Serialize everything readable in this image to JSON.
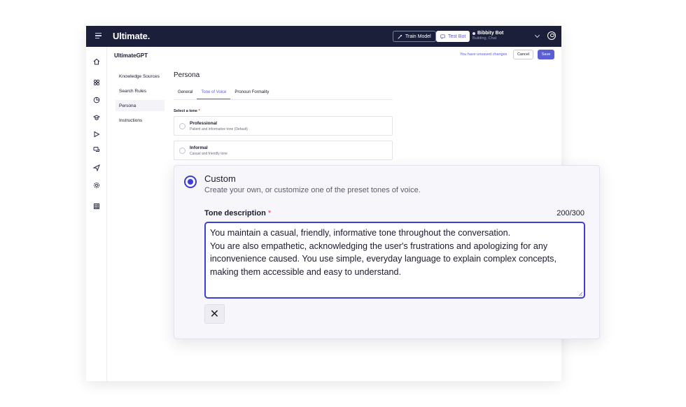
{
  "topbar": {
    "logo": "Ultimate.",
    "train_label": "Train Model",
    "test_label": "Test Bot",
    "bot_name": "Bibbity Bot",
    "bot_sub": "Building, Chat"
  },
  "header": {
    "app_name": "UltimateGPT",
    "unsaved": "You have unsaved changes",
    "cancel": "Cancel",
    "save": "Save"
  },
  "subnav": {
    "items": [
      {
        "label": "Knowledge Sources"
      },
      {
        "label": "Search Rules"
      },
      {
        "label": "Persona"
      },
      {
        "label": "Instructions"
      }
    ]
  },
  "persona": {
    "title": "Persona",
    "tabs": [
      {
        "label": "General"
      },
      {
        "label": "Tone of Voice"
      },
      {
        "label": "Pronoun Formality"
      }
    ],
    "select_label": "Select a tone",
    "required_mark": "*",
    "tones": [
      {
        "title": "Professional",
        "sub": "Patient and informative tone (Default)"
      },
      {
        "title": "Informal",
        "sub": "Casual and friendly tone"
      }
    ]
  },
  "custom": {
    "title": "Custom",
    "subtitle": "Create your own, or customize one of the preset tones of voice.",
    "desc_label": "Tone description",
    "required_mark": "*",
    "counter": "200/300",
    "description": "You maintain a casual, friendly, informative tone throughout the conversation.\nYou are also empathetic, acknowledging the user's frustrations and apologizing for any inconvenience caused. You use simple, everyday language to explain complex concepts, making them accessible and easy to understand.",
    "close_glyph": "✕"
  },
  "icons": {
    "rail": [
      "home-icon",
      "grid-icon",
      "chart-icon",
      "graduation-cap-icon",
      "play-icon",
      "chat-icon",
      "send-icon",
      "gear-icon",
      "table-icon"
    ]
  },
  "colors": {
    "accent": "#5a5fd8",
    "accent_strong": "#3c3fd1",
    "topbar": "#1c1f3a",
    "required": "#e0394f"
  }
}
